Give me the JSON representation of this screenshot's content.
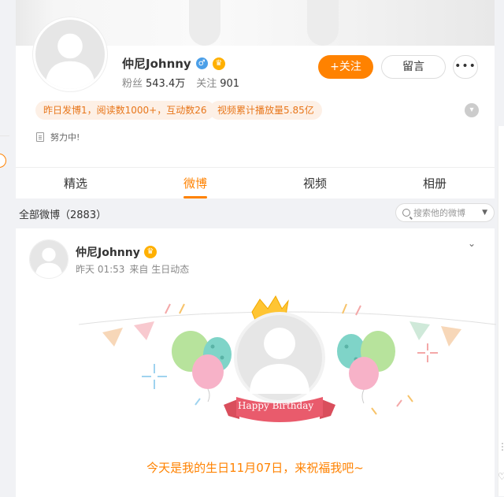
{
  "profile": {
    "username": "仲尼Johnny",
    "gender_icon": "♂",
    "followers_label": "粉丝",
    "followers_value": "543.4万",
    "following_label": "关注",
    "following_value": "901",
    "follow_button": "+关注",
    "message_button": "留言",
    "more_button": "•••",
    "tag1": "昨日发博1，阅读数1000+，互动数26",
    "tag2": "视频累计播放量5.85亿",
    "bio": "努力中!"
  },
  "tabs": [
    {
      "label": "精选"
    },
    {
      "label": "微博"
    },
    {
      "label": "视频"
    },
    {
      "label": "相册"
    }
  ],
  "feed": {
    "header": "全部微博（2883）",
    "search_placeholder": "搜索他的微博"
  },
  "post": {
    "author": "仲尼Johnny",
    "time": "昨天 01:53",
    "source": "来自 生日动态",
    "banner_text": "Happy Birthday",
    "text": "今天是我的生日11月07日，来祝福我吧~"
  },
  "colors": {
    "accent": "#ff8200",
    "tag_bg": "#fdf0e6",
    "tag_text": "#e8761a"
  },
  "icons": [
    "avatar-placeholder",
    "male-gender-icon",
    "vip-crown-icon",
    "more-icon",
    "document-icon",
    "search-icon",
    "chevron-down-icon",
    "crown-icon",
    "balloon-icon"
  ]
}
